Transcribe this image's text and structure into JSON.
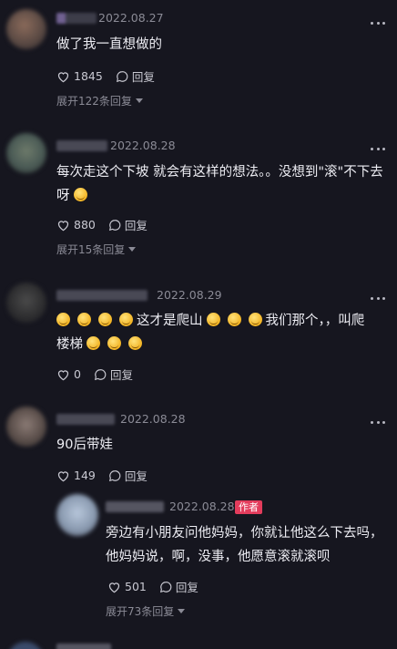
{
  "comments": [
    {
      "date": "2022.08.27",
      "text": "做了我一直想做的",
      "likes": "1845",
      "reply_label": "回复",
      "expand": "展开122条回复"
    },
    {
      "date": "2022.08.28",
      "line1": "每次走这个下坡 就会有这样的想法。。没想到\"滚\"不下去",
      "line2": "呀",
      "likes": "880",
      "reply_label": "回复",
      "expand": "展开15条回复"
    },
    {
      "date": "2022.08.29",
      "line1": "这才是爬山",
      "line1b": "我们那个，，叫爬",
      "line2": "楼梯",
      "likes": "0",
      "reply_label": "回复"
    },
    {
      "date": "2022.08.28",
      "text": "90后带娃",
      "likes": "149",
      "reply_label": "回复"
    }
  ],
  "reply": {
    "date": "2022.08.28",
    "author_tag": "作者",
    "line1": "旁边有小朋友问他妈妈，你就让他这么下去吗，",
    "line2": "他妈妈说，啊，没事，他愿意滚就滚呗",
    "likes": "501",
    "reply_label": "回复",
    "expand": "展开73条回复"
  },
  "colors": {
    "background": "#16161f",
    "author_tag": "#e33c5c",
    "muted_text": "#8b8b96"
  }
}
